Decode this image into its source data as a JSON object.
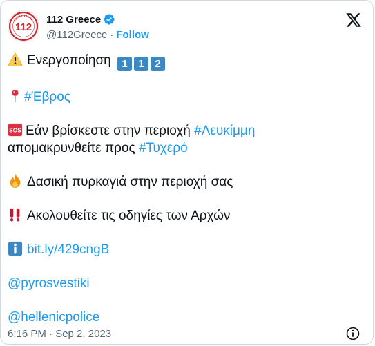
{
  "author": {
    "display_name": "112 Greece",
    "handle": "@112Greece",
    "separator": "·",
    "follow_label": "Follow",
    "avatar_text": "112",
    "verified_color": "#1d9bf0"
  },
  "tweet": {
    "line1_text": "Ενεργοποίηση",
    "line1_emoji": "warning-icon",
    "line1_keys": [
      "1",
      "1",
      "2"
    ],
    "line2_emoji": "round-pushpin-icon",
    "line2_hashtag": "#Έβρος",
    "line3_emoji": "sos-icon",
    "line3_text": "Εάν βρίσκεστε στην περιοχή",
    "line3_hashtag": "#Λευκίμμη",
    "line4_text": "απομακρυνθείτε προς",
    "line4_hashtag": "#Τυχερό",
    "line5_emoji": "fire-icon",
    "line5_text": "Δασική πυρκαγιά στην περιοχή σας",
    "line6_emoji": "double-exclamation-icon",
    "line6_text": "Ακολουθείτε τις οδηγίες των Αρχών",
    "line7_emoji": "information-icon",
    "line7_link": "bit.ly/429cngB",
    "mention1": "@pyrosvestiki",
    "mention2": "@hellenicpolice"
  },
  "footer": {
    "timestamp": "6:16 PM · Sep 2, 2023"
  },
  "colors": {
    "link": "#1d9bf0",
    "text": "#0f1419",
    "muted": "#536471",
    "border": "#cfd9de"
  }
}
